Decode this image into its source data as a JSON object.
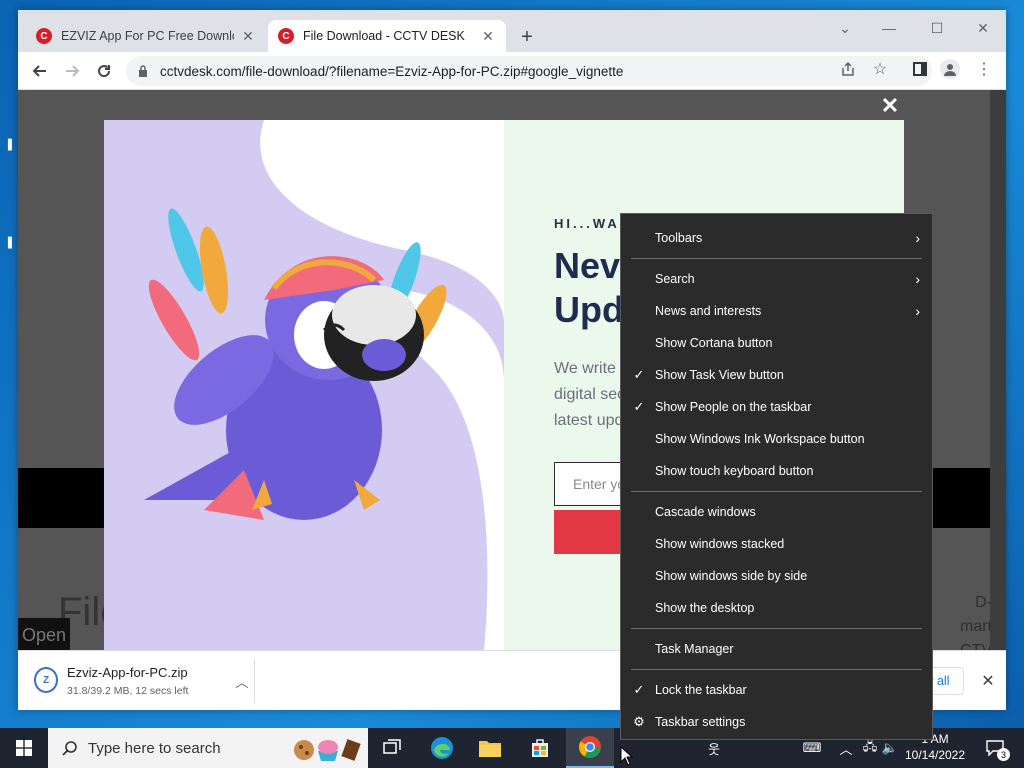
{
  "browser": {
    "tabs": [
      {
        "title": "EZVIZ App For PC Free Download",
        "active": false
      },
      {
        "title": "File Download - CCTV DESK",
        "active": true
      }
    ],
    "url": "cctvdesk.com/file-download/?filename=Ezviz-App-for-PC.zip#google_vignette"
  },
  "page": {
    "modal": {
      "kicker": "HI...WAIT",
      "headline_lines": [
        "Nev",
        "Upd"
      ],
      "paragraph_lines": [
        "We write e",
        "digital sec",
        "latest upd"
      ],
      "email_placeholder": "Enter yo"
    },
    "background_heading": "File",
    "background_right_lines": [
      "D-",
      "mart",
      "CTV"
    ],
    "open_label": "Open"
  },
  "download_bar": {
    "file_name": "Ezviz-App-for-PC.zip",
    "status": "31.8/39.2 MB, 12 secs left",
    "show_all_label": "w all"
  },
  "taskbar": {
    "search_placeholder": "Type here to search",
    "time": "1 AM",
    "date": "10/14/2022",
    "notification_count": "3"
  },
  "context_menu": {
    "items": [
      {
        "label": "Toolbars",
        "checked": false,
        "submenu": true
      },
      {
        "label": "Search",
        "checked": false,
        "submenu": true
      },
      {
        "label": "News and interests",
        "checked": false,
        "submenu": true
      },
      {
        "label": "Show Cortana button",
        "checked": false,
        "submenu": false
      },
      {
        "label": "Show Task View button",
        "checked": true,
        "submenu": false
      },
      {
        "label": "Show People on the taskbar",
        "checked": true,
        "submenu": false
      },
      {
        "label": "Show Windows Ink Workspace button",
        "checked": false,
        "submenu": false
      },
      {
        "label": "Show touch keyboard button",
        "checked": false,
        "submenu": false
      },
      {
        "label": "Cascade windows",
        "checked": false,
        "submenu": false
      },
      {
        "label": "Show windows stacked",
        "checked": false,
        "submenu": false
      },
      {
        "label": "Show windows side by side",
        "checked": false,
        "submenu": false
      },
      {
        "label": "Show the desktop",
        "checked": false,
        "submenu": false
      },
      {
        "label": "Task Manager",
        "checked": false,
        "submenu": false
      },
      {
        "label": "Lock the taskbar",
        "checked": true,
        "submenu": false
      },
      {
        "label": "Taskbar settings",
        "checked": false,
        "submenu": false
      }
    ]
  },
  "colors": {
    "accent_red": "#e23845",
    "headline_navy": "#1d2c4f",
    "menu_bg": "#2b2b2b",
    "taskbar_bg": "#1f2530"
  }
}
